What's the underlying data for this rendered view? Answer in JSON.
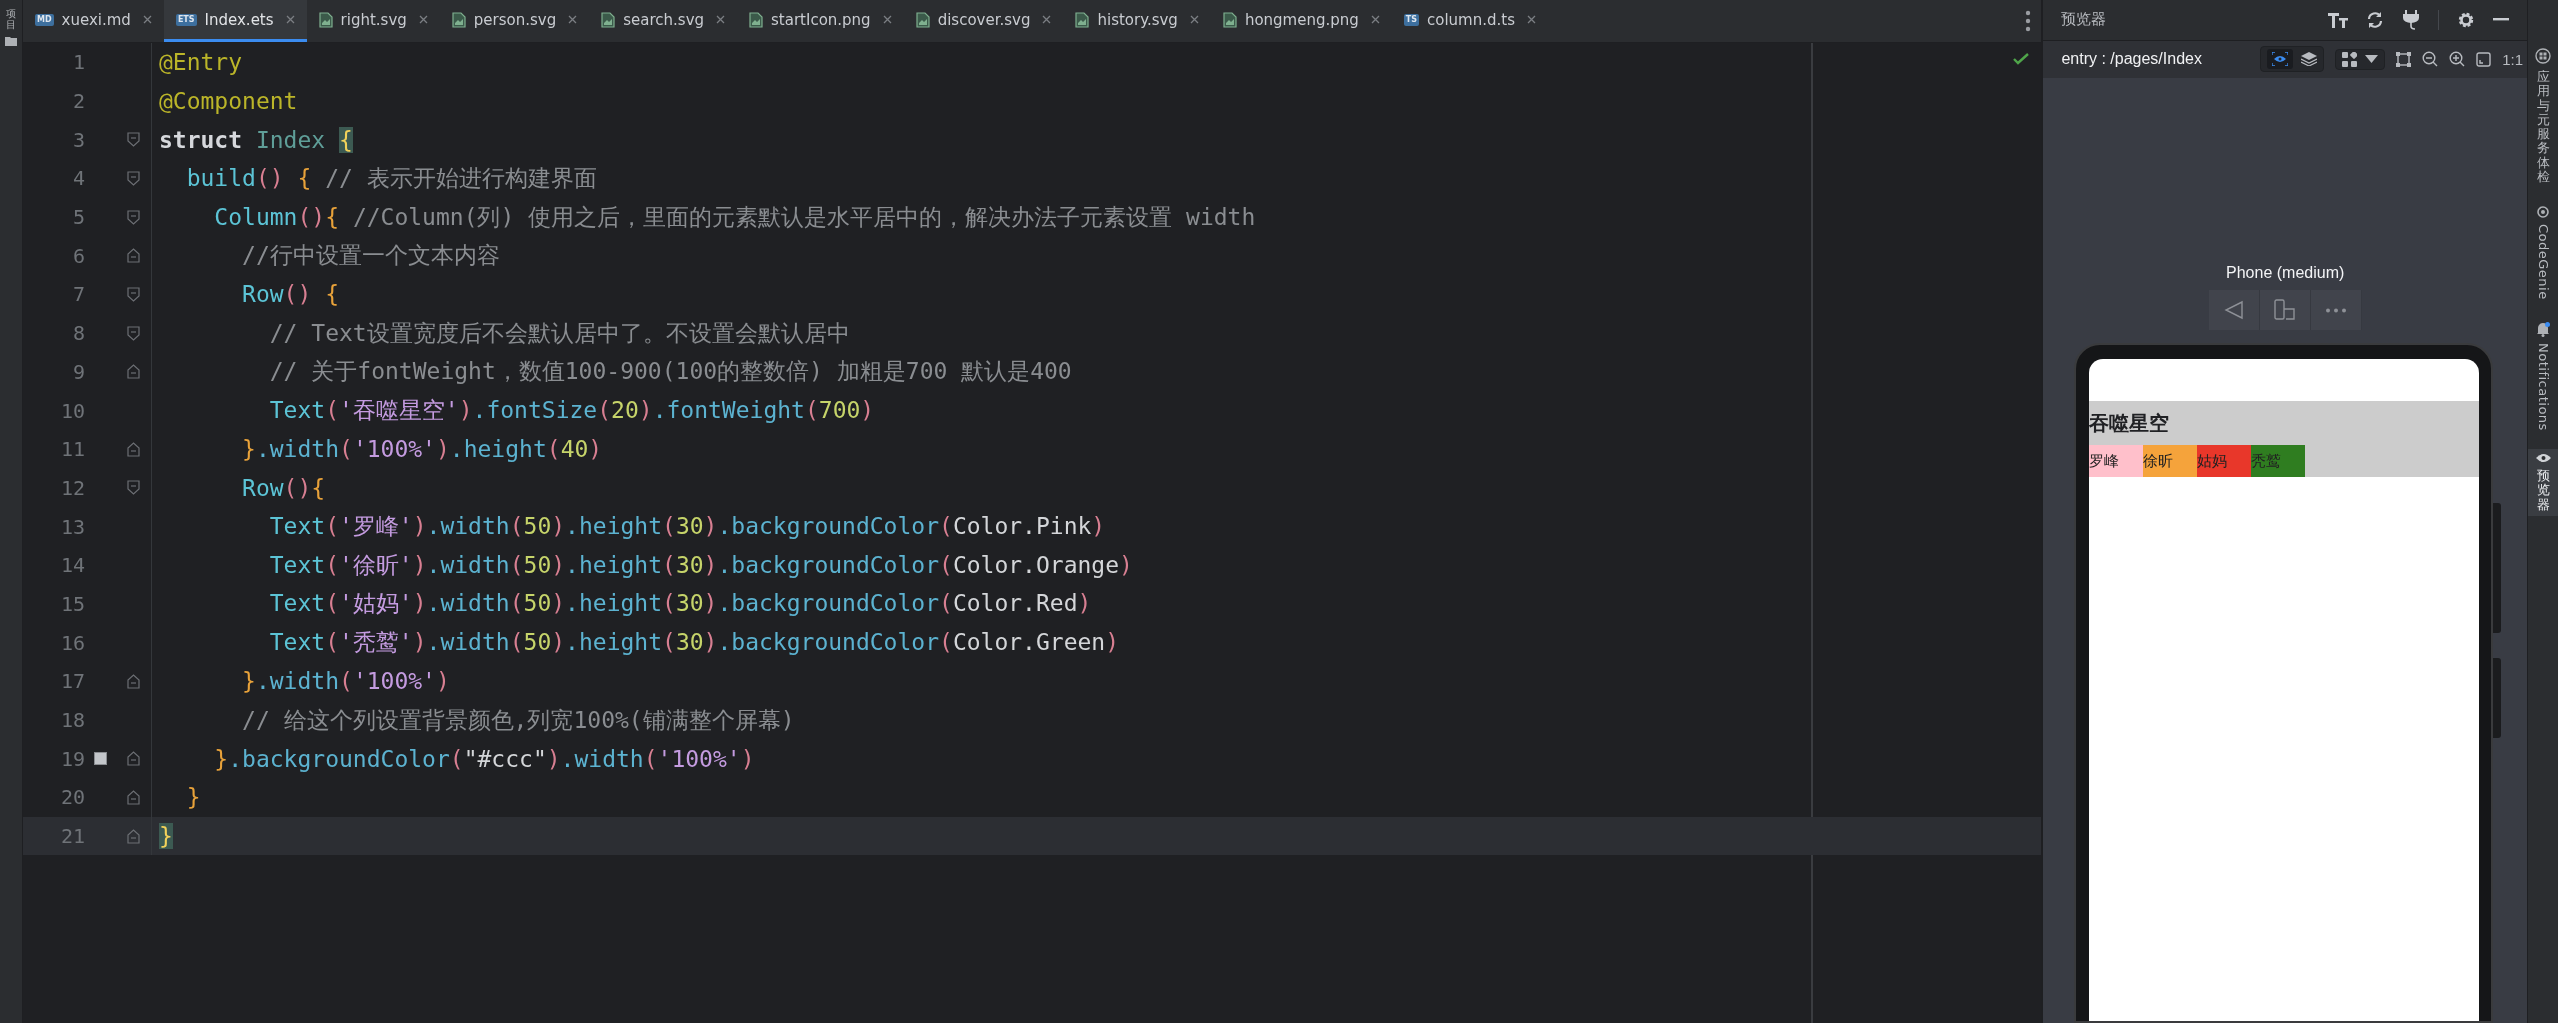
{
  "tool_strip": {
    "label": "项目"
  },
  "tabs": [
    {
      "label": "xuexi.md",
      "kind": "badge",
      "badge": "MD",
      "selected": false
    },
    {
      "label": "Index.ets",
      "kind": "badge",
      "badge": "ETS",
      "selected": true
    },
    {
      "label": "right.svg",
      "kind": "file",
      "selected": false
    },
    {
      "label": "person.svg",
      "kind": "file",
      "selected": false
    },
    {
      "label": "search.svg",
      "kind": "file",
      "selected": false
    },
    {
      "label": "startIcon.png",
      "kind": "file",
      "selected": false
    },
    {
      "label": "discover.svg",
      "kind": "file",
      "selected": false
    },
    {
      "label": "history.svg",
      "kind": "file",
      "selected": false
    },
    {
      "label": "hongmeng.png",
      "kind": "file",
      "selected": false
    },
    {
      "label": "column.d.ts",
      "kind": "badge",
      "badge": "TS",
      "selected": false
    }
  ],
  "editor": {
    "lines": [
      {
        "number": "1",
        "fold_start": false,
        "fold_end": false,
        "marked": false,
        "current": false,
        "tokens": [
          {
            "kind": "annotation",
            "text": "@Entry"
          }
        ]
      },
      {
        "number": "2",
        "fold_start": false,
        "fold_end": false,
        "marked": false,
        "current": false,
        "tokens": [
          {
            "kind": "annotation",
            "text": "@Component"
          }
        ]
      },
      {
        "number": "3",
        "fold_start": true,
        "fold_end": false,
        "marked": false,
        "current": false,
        "tokens": [
          {
            "kind": "keyword",
            "text": "struct "
          },
          {
            "kind": "class",
            "text": "Index "
          },
          {
            "kind": "brace_match",
            "text": "{"
          }
        ]
      },
      {
        "number": "4",
        "fold_start": true,
        "fold_end": false,
        "marked": false,
        "current": false,
        "tokens": [
          {
            "kind": "func",
            "text": "  build"
          },
          {
            "kind": "paren",
            "text": "() "
          },
          {
            "kind": "brace",
            "text": "{ "
          },
          {
            "kind": "comment",
            "text": "// 表示开始进行构建界面"
          }
        ]
      },
      {
        "number": "5",
        "fold_start": true,
        "fold_end": false,
        "marked": false,
        "current": false,
        "tokens": [
          {
            "kind": "func",
            "text": "    Column"
          },
          {
            "kind": "paren",
            "text": "()"
          },
          {
            "kind": "brace",
            "text": "{ "
          },
          {
            "kind": "comment",
            "text": "//Column(列) 使用之后，里面的元素默认是水平居中的，解决办法子元素设置 width"
          }
        ]
      },
      {
        "number": "6",
        "fold_start": false,
        "fold_end": true,
        "marked": false,
        "current": false,
        "tokens": [
          {
            "kind": "comment",
            "text": "      //行中设置一个文本内容"
          }
        ]
      },
      {
        "number": "7",
        "fold_start": true,
        "fold_end": false,
        "marked": false,
        "current": false,
        "tokens": [
          {
            "kind": "func",
            "text": "      Row"
          },
          {
            "kind": "paren",
            "text": "() "
          },
          {
            "kind": "brace",
            "text": "{"
          }
        ]
      },
      {
        "number": "8",
        "fold_start": true,
        "fold_end": false,
        "marked": false,
        "current": false,
        "tokens": [
          {
            "kind": "comment",
            "text": "        // Text设置宽度后不会默认居中了。不设置会默认居中"
          }
        ]
      },
      {
        "number": "9",
        "fold_start": false,
        "fold_end": true,
        "marked": false,
        "current": false,
        "tokens": [
          {
            "kind": "comment",
            "text": "        // 关于fontWeight，数值100-900(100的整数倍) 加粗是700 默认是400"
          }
        ]
      },
      {
        "number": "10",
        "fold_start": false,
        "fold_end": false,
        "marked": false,
        "current": false,
        "tokens": [
          {
            "kind": "func",
            "text": "        Text"
          },
          {
            "kind": "paren",
            "text": "("
          },
          {
            "kind": "string",
            "text": "'吞噬星空'"
          },
          {
            "kind": "paren",
            "text": ")"
          },
          {
            "kind": "method",
            "text": ".fontSize"
          },
          {
            "kind": "paren",
            "text": "("
          },
          {
            "kind": "number",
            "text": "20"
          },
          {
            "kind": "paren",
            "text": ")"
          },
          {
            "kind": "method",
            "text": ".fontWeight"
          },
          {
            "kind": "paren",
            "text": "("
          },
          {
            "kind": "number",
            "text": "700"
          },
          {
            "kind": "paren",
            "text": ")"
          }
        ]
      },
      {
        "number": "11",
        "fold_start": false,
        "fold_end": true,
        "marked": false,
        "current": false,
        "tokens": [
          {
            "kind": "brace",
            "text": "      }"
          },
          {
            "kind": "method",
            "text": ".width"
          },
          {
            "kind": "paren",
            "text": "("
          },
          {
            "kind": "string",
            "text": "'100%'"
          },
          {
            "kind": "paren",
            "text": ")"
          },
          {
            "kind": "method",
            "text": ".height"
          },
          {
            "kind": "paren",
            "text": "("
          },
          {
            "kind": "number",
            "text": "40"
          },
          {
            "kind": "paren",
            "text": ")"
          }
        ]
      },
      {
        "number": "12",
        "fold_start": true,
        "fold_end": false,
        "marked": false,
        "current": false,
        "tokens": [
          {
            "kind": "func",
            "text": "      Row"
          },
          {
            "kind": "paren",
            "text": "()"
          },
          {
            "kind": "brace",
            "text": "{"
          }
        ]
      },
      {
        "number": "13",
        "fold_start": false,
        "fold_end": false,
        "marked": false,
        "current": false,
        "tokens": [
          {
            "kind": "func",
            "text": "        Text"
          },
          {
            "kind": "paren",
            "text": "("
          },
          {
            "kind": "string",
            "text": "'罗峰'"
          },
          {
            "kind": "paren",
            "text": ")"
          },
          {
            "kind": "method",
            "text": ".width"
          },
          {
            "kind": "paren",
            "text": "("
          },
          {
            "kind": "number",
            "text": "50"
          },
          {
            "kind": "paren",
            "text": ")"
          },
          {
            "kind": "method",
            "text": ".height"
          },
          {
            "kind": "paren",
            "text": "("
          },
          {
            "kind": "number",
            "text": "30"
          },
          {
            "kind": "paren",
            "text": ")"
          },
          {
            "kind": "method",
            "text": ".backgroundColor"
          },
          {
            "kind": "paren",
            "text": "("
          },
          {
            "kind": "plain",
            "text": "Color.Pink"
          },
          {
            "kind": "paren",
            "text": ")"
          }
        ]
      },
      {
        "number": "14",
        "fold_start": false,
        "fold_end": false,
        "marked": false,
        "current": false,
        "tokens": [
          {
            "kind": "func",
            "text": "        Text"
          },
          {
            "kind": "paren",
            "text": "("
          },
          {
            "kind": "string",
            "text": "'徐昕'"
          },
          {
            "kind": "paren",
            "text": ")"
          },
          {
            "kind": "method",
            "text": ".width"
          },
          {
            "kind": "paren",
            "text": "("
          },
          {
            "kind": "number",
            "text": "50"
          },
          {
            "kind": "paren",
            "text": ")"
          },
          {
            "kind": "method",
            "text": ".height"
          },
          {
            "kind": "paren",
            "text": "("
          },
          {
            "kind": "number",
            "text": "30"
          },
          {
            "kind": "paren",
            "text": ")"
          },
          {
            "kind": "method",
            "text": ".backgroundColor"
          },
          {
            "kind": "paren",
            "text": "("
          },
          {
            "kind": "plain",
            "text": "Color.Orange"
          },
          {
            "kind": "paren",
            "text": ")"
          }
        ]
      },
      {
        "number": "15",
        "fold_start": false,
        "fold_end": false,
        "marked": false,
        "current": false,
        "tokens": [
          {
            "kind": "func",
            "text": "        Text"
          },
          {
            "kind": "paren",
            "text": "("
          },
          {
            "kind": "string",
            "text": "'姑妈'"
          },
          {
            "kind": "paren",
            "text": ")"
          },
          {
            "kind": "method",
            "text": ".width"
          },
          {
            "kind": "paren",
            "text": "("
          },
          {
            "kind": "number",
            "text": "50"
          },
          {
            "kind": "paren",
            "text": ")"
          },
          {
            "kind": "method",
            "text": ".height"
          },
          {
            "kind": "paren",
            "text": "("
          },
          {
            "kind": "number",
            "text": "30"
          },
          {
            "kind": "paren",
            "text": ")"
          },
          {
            "kind": "method",
            "text": ".backgroundColor"
          },
          {
            "kind": "paren",
            "text": "("
          },
          {
            "kind": "plain",
            "text": "Color.Red"
          },
          {
            "kind": "paren",
            "text": ")"
          }
        ]
      },
      {
        "number": "16",
        "fold_start": false,
        "fold_end": false,
        "marked": false,
        "current": false,
        "tokens": [
          {
            "kind": "func",
            "text": "        Text"
          },
          {
            "kind": "paren",
            "text": "("
          },
          {
            "kind": "string",
            "text": "'秃鹫'"
          },
          {
            "kind": "paren",
            "text": ")"
          },
          {
            "kind": "method",
            "text": ".width"
          },
          {
            "kind": "paren",
            "text": "("
          },
          {
            "kind": "number",
            "text": "50"
          },
          {
            "kind": "paren",
            "text": ")"
          },
          {
            "kind": "method",
            "text": ".height"
          },
          {
            "kind": "paren",
            "text": "("
          },
          {
            "kind": "number",
            "text": "30"
          },
          {
            "kind": "paren",
            "text": ")"
          },
          {
            "kind": "method",
            "text": ".backgroundColor"
          },
          {
            "kind": "paren",
            "text": "("
          },
          {
            "kind": "plain",
            "text": "Color.Green"
          },
          {
            "kind": "paren",
            "text": ")"
          }
        ]
      },
      {
        "number": "17",
        "fold_start": false,
        "fold_end": true,
        "marked": false,
        "current": false,
        "tokens": [
          {
            "kind": "brace",
            "text": "      }"
          },
          {
            "kind": "method",
            "text": ".width"
          },
          {
            "kind": "paren",
            "text": "("
          },
          {
            "kind": "string",
            "text": "'100%'"
          },
          {
            "kind": "paren",
            "text": ")"
          }
        ]
      },
      {
        "number": "18",
        "fold_start": false,
        "fold_end": false,
        "marked": false,
        "current": false,
        "tokens": [
          {
            "kind": "comment",
            "text": "      // 给这个列设置背景颜色,列宽100%(铺满整个屏幕)"
          }
        ]
      },
      {
        "number": "19",
        "fold_start": false,
        "fold_end": true,
        "marked": true,
        "current": false,
        "tokens": [
          {
            "kind": "brace",
            "text": "    }"
          },
          {
            "kind": "method",
            "text": ".backgroundColor"
          },
          {
            "kind": "paren",
            "text": "("
          },
          {
            "kind": "plain",
            "text": "\"#ccc\""
          },
          {
            "kind": "paren",
            "text": ")"
          },
          {
            "kind": "method",
            "text": ".width"
          },
          {
            "kind": "paren",
            "text": "("
          },
          {
            "kind": "string",
            "text": "'100%'"
          },
          {
            "kind": "paren",
            "text": ")"
          }
        ]
      },
      {
        "number": "20",
        "fold_start": false,
        "fold_end": true,
        "marked": false,
        "current": false,
        "tokens": [
          {
            "kind": "brace",
            "text": "  }"
          }
        ]
      },
      {
        "number": "21",
        "fold_start": false,
        "fold_end": true,
        "marked": false,
        "current": true,
        "tokens": [
          {
            "kind": "brace_match",
            "text": "}"
          }
        ]
      }
    ]
  },
  "preview": {
    "title": "预览器",
    "page": "entry : /pages/Index",
    "zoom_reset": "1:1",
    "inspect_on": true,
    "device": "Phone (medium)",
    "screen": {
      "title": "吞噬星空",
      "cells": [
        {
          "label": "罗峰",
          "color": "#ffc0cb"
        },
        {
          "label": "徐昕",
          "color": "#f5a33b"
        },
        {
          "label": "姑妈",
          "color": "#e8372a"
        },
        {
          "label": "秃鹫",
          "color": "#2f7d20"
        }
      ]
    }
  },
  "side_tabs": [
    {
      "label": "应用与元服务体检",
      "kind": "cjk",
      "selected": false
    },
    {
      "label": "CodeGenie",
      "kind": "latin",
      "selected": false
    },
    {
      "label": "Notifications",
      "kind": "latin",
      "selected": false
    },
    {
      "label": "预览器",
      "kind": "cjk",
      "selected": true
    }
  ]
}
